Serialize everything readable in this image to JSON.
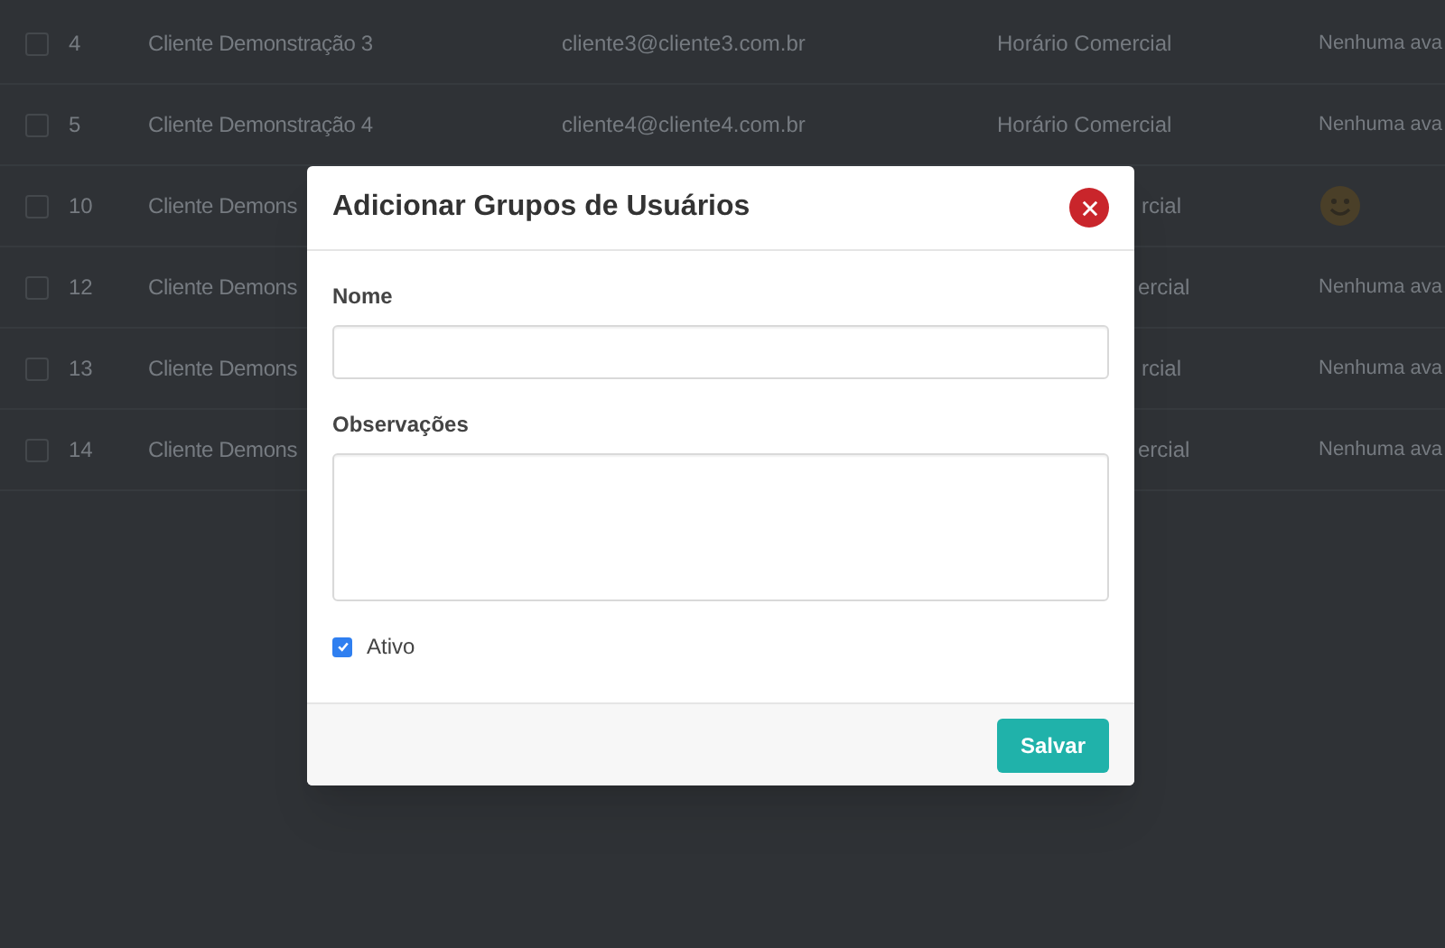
{
  "table": {
    "rows": [
      {
        "checked": false,
        "id": "4",
        "name": "Cliente Demonstração 3",
        "email": "cliente3@cliente3.com.br",
        "schedule": "Horário Comercial",
        "rating": {
          "kind": "text",
          "text": "Nenhuma ava"
        }
      },
      {
        "checked": false,
        "id": "5",
        "name": "Cliente Demonstração 4",
        "email": "cliente4@cliente4.com.br",
        "schedule": "Horário Comercial",
        "rating": {
          "kind": "text",
          "text": "Nenhuma ava"
        }
      },
      {
        "checked": false,
        "id": "10",
        "name": "Cliente Demons",
        "schedule": "rcial",
        "rating": {
          "kind": "smiley"
        }
      },
      {
        "checked": false,
        "id": "12",
        "name": "Cliente Demons",
        "schedule": "ercial",
        "rating": {
          "kind": "text",
          "text": "Nenhuma ava"
        }
      },
      {
        "checked": false,
        "id": "13",
        "name": "Cliente Demons",
        "schedule": "rcial",
        "rating": {
          "kind": "text",
          "text": "Nenhuma ava"
        }
      },
      {
        "checked": false,
        "id": "14",
        "name": "Cliente Demons",
        "schedule": "ercial",
        "rating": {
          "kind": "text",
          "text": "Nenhuma ava"
        }
      }
    ]
  },
  "modal": {
    "title": "Adicionar Grupos de Usuários",
    "fields": [
      {
        "kind": "input",
        "label": "Nome"
      },
      {
        "kind": "textarea",
        "label": "Observações"
      }
    ],
    "active": {
      "label": "Ativo",
      "checked": true
    },
    "buttons": [
      "Salvar"
    ]
  }
}
